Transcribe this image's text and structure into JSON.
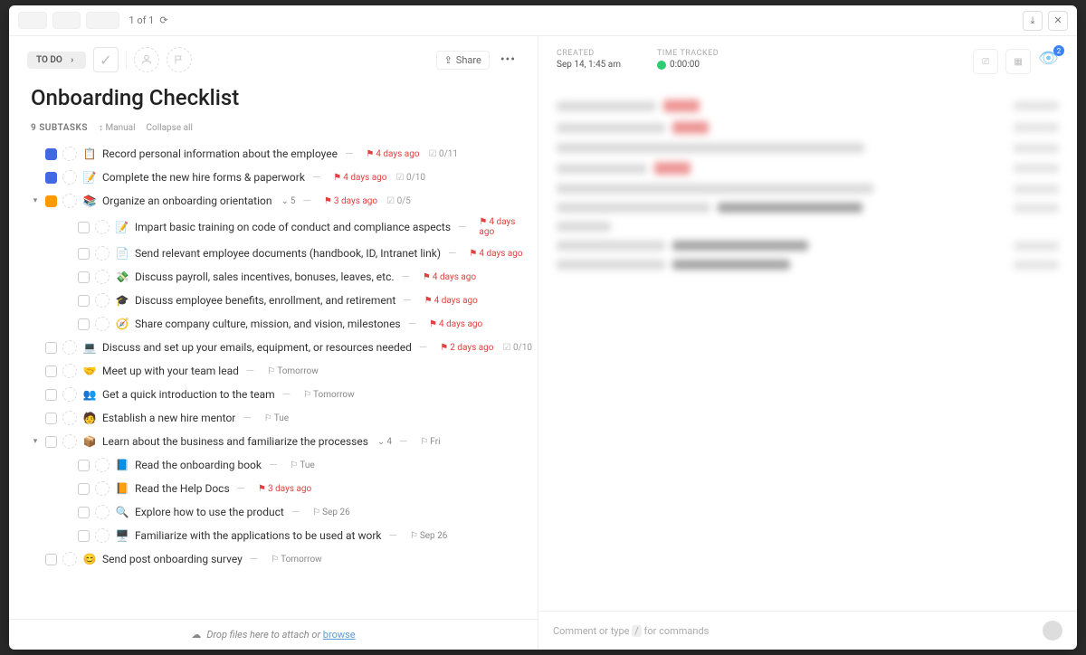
{
  "topbar": {
    "tabs": [
      "",
      "",
      ""
    ],
    "pager": "1 of 1"
  },
  "toolbar": {
    "status": "TO DO",
    "share": "Share"
  },
  "title": "Onboarding Checklist",
  "subheader": {
    "count": "9 SUBTASKS",
    "manual": "Manual",
    "collapse": "Collapse all"
  },
  "meta": {
    "created_label": "CREATED",
    "created_value": "Sep 14, 1:45 am",
    "tracked_label": "TIME TRACKED",
    "tracked_value": "0:00:00",
    "watchers": "2"
  },
  "footer": {
    "drop": "Drop files here to attach or ",
    "browse": "browse",
    "comment": "Comment or type ",
    "slash": "/",
    "commands": " for commands"
  },
  "tasks": [
    {
      "id": 0,
      "box": "blue",
      "emoji": "📋",
      "title": "Record personal information about the employee",
      "due": "4 days ago",
      "due_color": "red",
      "flag": "🚩",
      "progress": "0/11"
    },
    {
      "id": 1,
      "box": "blue",
      "emoji": "📝",
      "title": "Complete the new hire forms & paperwork",
      "due": "4 days ago",
      "due_color": "red",
      "flag": "🏳️",
      "progress": "0/10"
    },
    {
      "id": 2,
      "box": "orange",
      "emoji": "📚",
      "title": "Organize an onboarding orientation",
      "sub_count": "5",
      "due": "3 days ago",
      "due_color": "red",
      "flag": "🚩",
      "progress": "0/5",
      "expanded": true
    },
    {
      "id": 3,
      "nested": true,
      "box": "grey",
      "emoji": "📝",
      "title": "Impart basic training on code of conduct and compliance aspects",
      "due": "4 days ago",
      "due_color": "red",
      "flag": "🚩"
    },
    {
      "id": 4,
      "nested": true,
      "box": "grey",
      "emoji": "📄",
      "title": "Send relevant employee documents (handbook, ID, Intranet link)",
      "due": "4 days ago",
      "due_color": "red",
      "flag": "🚩"
    },
    {
      "id": 5,
      "nested": true,
      "box": "grey",
      "emoji": "💸",
      "title": "Discuss payroll, sales incentives, bonuses, leaves, etc.",
      "due": "4 days ago",
      "due_color": "red",
      "flag": "🚩"
    },
    {
      "id": 6,
      "nested": true,
      "box": "grey",
      "emoji": "🎓",
      "title": "Discuss employee benefits, enrollment, and retirement",
      "due": "4 days ago",
      "due_color": "red",
      "flag": "🚩"
    },
    {
      "id": 7,
      "nested": true,
      "box": "grey",
      "emoji": "🧭",
      "title": "Share company culture, mission, and vision, milestones",
      "due": "4 days ago",
      "due_color": "red",
      "flag": "🚩"
    },
    {
      "id": 8,
      "box": "grey",
      "emoji": "💻",
      "title": "Discuss and set up your emails, equipment, or resources needed",
      "due": "2 days ago",
      "due_color": "red",
      "flag": "🚩",
      "progress": "0/10"
    },
    {
      "id": 9,
      "box": "grey",
      "emoji": "🤝",
      "title": "Meet up with your team lead",
      "due": "Tomorrow",
      "due_color": "grey",
      "flag": "🏳️"
    },
    {
      "id": 10,
      "box": "grey",
      "emoji": "👥",
      "title": "Get a quick introduction to the team",
      "due": "Tomorrow",
      "due_color": "grey",
      "flag": "🏳️"
    },
    {
      "id": 11,
      "box": "grey",
      "emoji": "🧑",
      "title": "Establish a new hire mentor",
      "due": "Tue",
      "due_color": "grey",
      "flag": "🏳️"
    },
    {
      "id": 12,
      "box": "grey",
      "emoji": "📦",
      "title": "Learn about the business and familiarize the processes",
      "sub_count": "4",
      "due": "Fri",
      "due_color": "grey",
      "flag": "🏳️",
      "expanded": true
    },
    {
      "id": 13,
      "nested": true,
      "box": "grey",
      "emoji": "📘",
      "title": "Read the onboarding book",
      "due": "Tue",
      "due_color": "grey",
      "flag": "🏳️"
    },
    {
      "id": 14,
      "nested": true,
      "box": "grey",
      "emoji": "📙",
      "title": "Read the Help Docs",
      "due": "3 days ago",
      "due_color": "red",
      "flag": "🚩"
    },
    {
      "id": 15,
      "nested": true,
      "box": "grey",
      "emoji": "🔍",
      "title": "Explore how to use the product",
      "due": "Sep 26",
      "due_color": "grey",
      "flag": "🏳️"
    },
    {
      "id": 16,
      "nested": true,
      "box": "grey",
      "emoji": "🖥️",
      "title": "Familiarize with the applications to be used at work",
      "due": "Sep 26",
      "due_color": "grey",
      "flag": "🏳️"
    },
    {
      "id": 17,
      "box": "grey",
      "emoji": "😊",
      "title": "Send post onboarding survey",
      "due": "Tomorrow",
      "due_color": "grey",
      "flag": "🏳️"
    }
  ]
}
